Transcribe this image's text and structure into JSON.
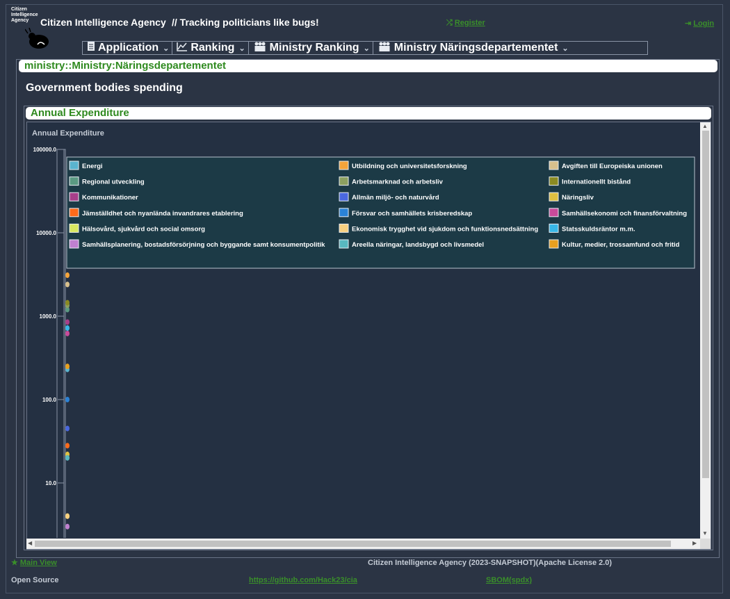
{
  "header": {
    "logo_text": "Citizen Intelligence Agency",
    "app_title": "Citizen Intelligence Agency",
    "tagline": "// Tracking politicians like bugs!",
    "register_label": "Register",
    "login_label": "Login"
  },
  "menu": {
    "items": [
      {
        "label": "Application",
        "icon": "document-icon"
      },
      {
        "label": "Ranking",
        "icon": "chart-line-icon"
      },
      {
        "label": "Ministry Ranking",
        "icon": "people-icon"
      },
      {
        "label": "Ministry Näringsdepartementet",
        "icon": "people-icon"
      }
    ]
  },
  "page": {
    "title": "ministry::Ministry:Näringsdepartementet",
    "heading": "Government bodies spending",
    "panel_title": "Annual Expenditure"
  },
  "chart_data": {
    "type": "scatter",
    "title": "Annual Expenditure",
    "y_scale": "log",
    "ylim": [
      1,
      100000
    ],
    "y_ticks": [
      "100000.0",
      "10000.0",
      "1000.0",
      "100.0",
      "10.0"
    ],
    "grid": false,
    "legend_position": "top",
    "series": [
      {
        "name": "Energi",
        "color": "#5ab4cf",
        "values": [
          230
        ]
      },
      {
        "name": "Utbildning och universitetsforskning",
        "color": "#f4a43a",
        "values": [
          3100
        ]
      },
      {
        "name": "Avgiften till Europeiska unionen",
        "color": "#d8c08c",
        "values": [
          2400
        ]
      },
      {
        "name": "Regional utveckling",
        "color": "#5a9a82",
        "values": [
          1200
        ]
      },
      {
        "name": "Arbetsmarknad och arbetsliv",
        "color": "#8ca060",
        "values": [
          1350
        ]
      },
      {
        "name": "Internationellt bistånd",
        "color": "#8a8a22",
        "values": [
          1450
        ]
      },
      {
        "name": "Kommunikationer",
        "color": "#a83f8a",
        "values": [
          850
        ]
      },
      {
        "name": "Allmän miljö- och naturvård",
        "color": "#4a68e0",
        "values": [
          45
        ]
      },
      {
        "name": "Näringsliv",
        "color": "#e0c040",
        "values": [
          22
        ]
      },
      {
        "name": "Jämställdhet och nyanlända invandrares etablering",
        "color": "#ff6a1a",
        "values": [
          28
        ]
      },
      {
        "name": "Försvar och samhällets krisberedskap",
        "color": "#2a82d6",
        "values": [
          100
        ]
      },
      {
        "name": "Samhällsekonomi och finansförvaltning",
        "color": "#c84a9a",
        "values": [
          620
        ]
      },
      {
        "name": "Hälsovård, sjukvård och social omsorg",
        "color": "#d8e860",
        "values": [
          4
        ]
      },
      {
        "name": "Ekonomisk trygghet vid sjukdom och funktionsnedsättning",
        "color": "#f8d080",
        "values": [
          4
        ]
      },
      {
        "name": "Statsskuldsräntor m.m.",
        "color": "#38b8e8",
        "values": [
          720
        ]
      },
      {
        "name": "Samhällsplanering, bostadsförsörjning och byggande samt konsumentpolitik",
        "color": "#c080d0",
        "values": [
          3
        ]
      },
      {
        "name": "Areella näringar, landsbygd och livsmedel",
        "color": "#58b8c0",
        "values": [
          20
        ]
      },
      {
        "name": "Kultur, medier, trossamfund och fritid",
        "color": "#e8a020",
        "values": [
          250
        ]
      }
    ]
  },
  "footer": {
    "main_view_label": "Main View",
    "version_text": "Citizen Intelligence Agency (2023-SNAPSHOT)(Apache License 2.0)",
    "open_source_label": "Open Source",
    "github_link": "https://github.com/Hack23/cia",
    "sbom_link": "SBOM(spdx)"
  }
}
